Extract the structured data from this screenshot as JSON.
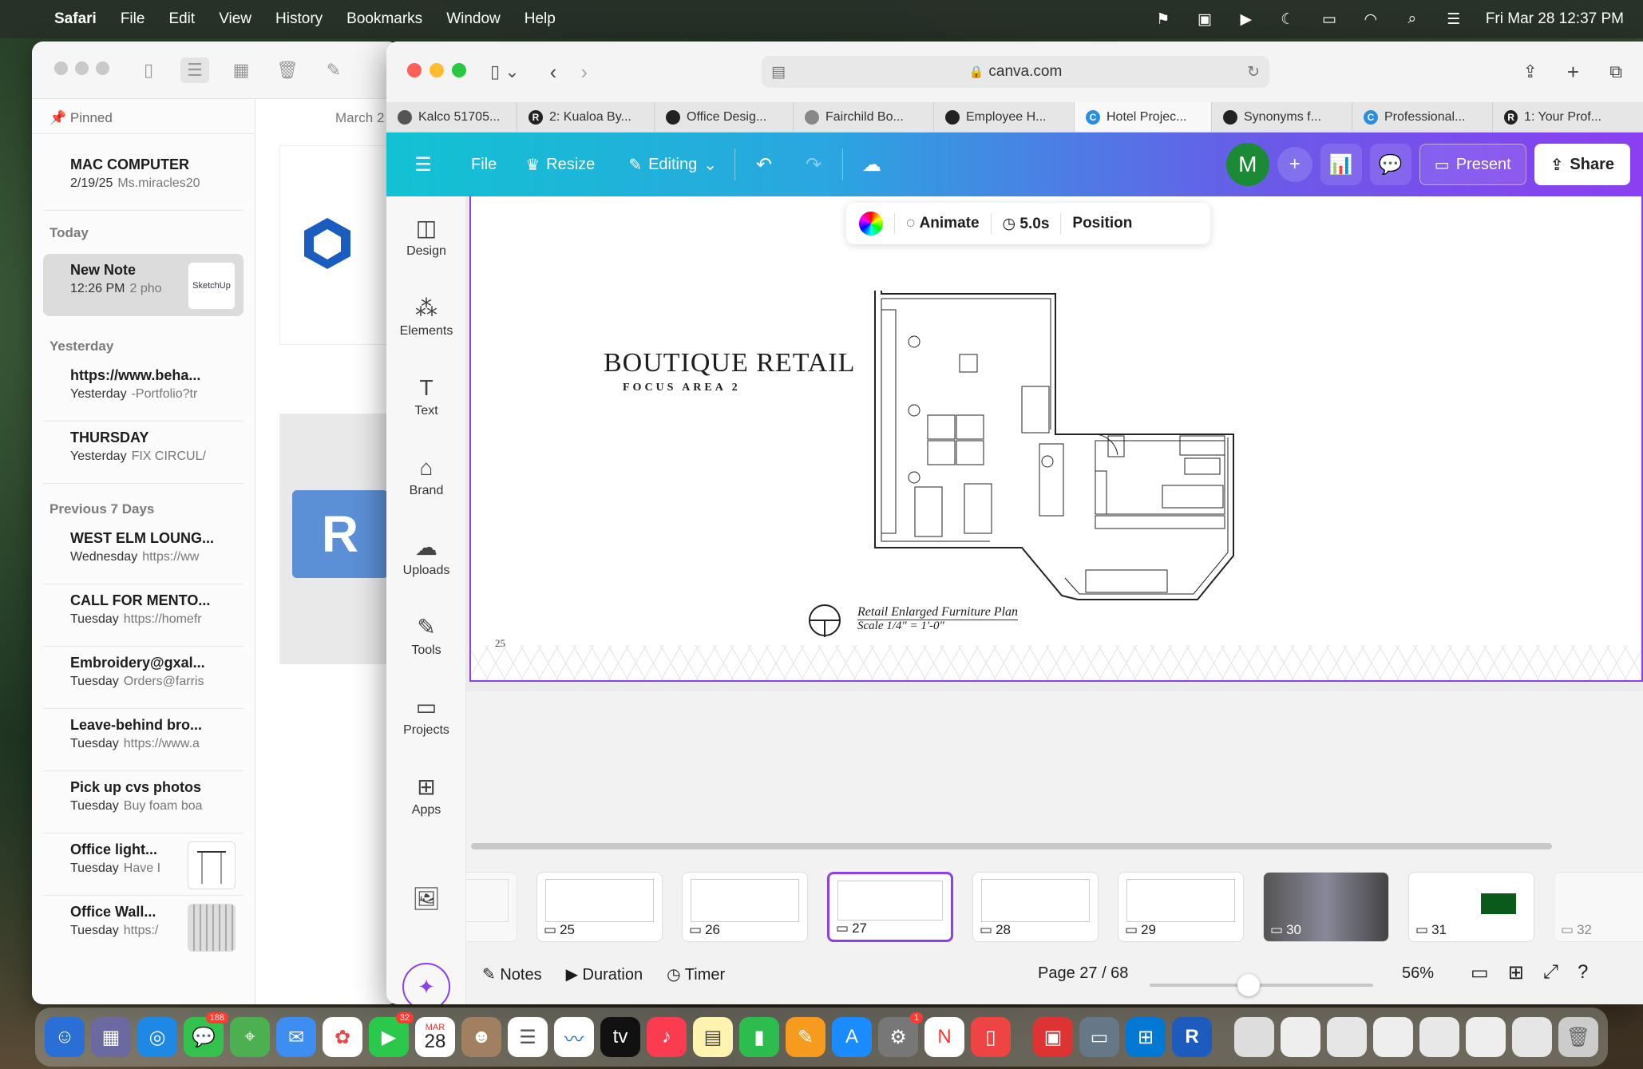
{
  "menubar": {
    "app": "Safari",
    "items": [
      "File",
      "Edit",
      "View",
      "History",
      "Bookmarks",
      "Window",
      "Help"
    ],
    "datetime": "Fri Mar 28  12:37 PM"
  },
  "notes": {
    "pinned_label": "Pinned",
    "pinned": [
      {
        "title": "MAC COMPUTER",
        "date": "2/19/25",
        "preview": "Ms.miracles20"
      }
    ],
    "sections": [
      {
        "label": "Today",
        "items": [
          {
            "title": "New Note",
            "date": "12:26 PM",
            "preview": "2 pho",
            "thumb": "SketchUp",
            "selected": true
          }
        ]
      },
      {
        "label": "Yesterday",
        "items": [
          {
            "title": "https://www.beha...",
            "date": "Yesterday",
            "preview": "-Portfolio?tr"
          },
          {
            "title": "THURSDAY",
            "date": "Yesterday",
            "preview": "FIX CIRCUL/"
          }
        ]
      },
      {
        "label": "Previous 7 Days",
        "items": [
          {
            "title": "WEST ELM LOUNG...",
            "date": "Wednesday",
            "preview": "https://ww"
          },
          {
            "title": "CALL FOR MENTO...",
            "date": "Tuesday",
            "preview": "https://homefr"
          },
          {
            "title": "Embroidery@gxal...",
            "date": "Tuesday",
            "preview": "Orders@farris"
          },
          {
            "title": "Leave-behind bro...",
            "date": "Tuesday",
            "preview": "https://www.a"
          },
          {
            "title": "Pick up cvs photos",
            "date": "Tuesday",
            "preview": "Buy foam boa"
          },
          {
            "title": "Office light...",
            "date": "Tuesday",
            "preview": "Have I"
          },
          {
            "title": "Office Wall...",
            "date": "Tuesday",
            "preview": "https:/"
          }
        ]
      }
    ],
    "body_date": "March 2"
  },
  "safari": {
    "url": "canva.com",
    "tabs": [
      {
        "label": "Kalco 51705...",
        "color": "#555"
      },
      {
        "label": "2: Kualoa By...",
        "color": "#222",
        "letter": "R"
      },
      {
        "label": "Office Desig...",
        "color": "#222"
      },
      {
        "label": "Fairchild Bo...",
        "color": "#777"
      },
      {
        "label": "Employee H...",
        "color": "#222"
      },
      {
        "label": "Hotel Projec...",
        "color": "#2a8ee0",
        "active": true
      },
      {
        "label": "Synonyms f...",
        "color": "#222"
      },
      {
        "label": "Professional...",
        "color": "#2a8ee0"
      },
      {
        "label": "1: Your Prof...",
        "color": "#222",
        "letter": "R"
      }
    ]
  },
  "canva": {
    "file": "File",
    "resize": "Resize",
    "editing": "Editing",
    "avatar": "M",
    "present": "Present",
    "share": "Share",
    "rail": [
      "Design",
      "Elements",
      "Text",
      "Brand",
      "Uploads",
      "Tools",
      "Projects",
      "Apps"
    ],
    "toolbar": {
      "animate": "Animate",
      "duration": "5.0s",
      "position": "Position"
    },
    "page": {
      "title": "BOUTIQUE RETAIL",
      "subtitle": "FOCUS AREA 2",
      "page_number": "25",
      "caption": "Retail Enlarged Furniture Plan",
      "scale": "Scale 1/4\" = 1'-0\""
    },
    "slides": [
      "25",
      "26",
      "27",
      "28",
      "29",
      "30",
      "31",
      "32"
    ],
    "active_slide": "27",
    "bottom": {
      "notes": "Notes",
      "duration": "Duration",
      "timer": "Timer",
      "page": "Page 27 / 68",
      "zoom": "56%"
    }
  },
  "dock": {
    "calendar_month": "MAR",
    "calendar_day": "28",
    "messages_badge": "188",
    "facetime_badge": "32",
    "settings_badge": "1"
  }
}
